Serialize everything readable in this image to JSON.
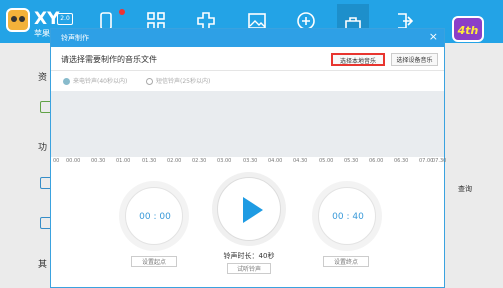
{
  "app": {
    "brand": "XY",
    "brand_sub": "苹果",
    "version": "2.0",
    "badge": "4th"
  },
  "nav": {
    "icons": [
      "phone-icon",
      "apps-icon",
      "puzzle-icon",
      "picture-icon",
      "plus-icon",
      "bag-icon",
      "export-icon"
    ]
  },
  "background": {
    "labels": [
      "资",
      "功",
      "其",
      "查询"
    ]
  },
  "dialog": {
    "title": "铃声制作",
    "close": "×",
    "prompt": "请选择需要制作的音乐文件",
    "btn_local": "选择本地音乐",
    "btn_device": "选择设备音乐",
    "radio_normal": "来电铃声(40秒以内)",
    "radio_sms": "短信铃声(25秒以内)",
    "ruler_ticks": [
      "00",
      "00.00",
      "00.30",
      "01.00",
      "01.30",
      "02.00",
      "02.30",
      "03.00",
      "03.30",
      "04.00",
      "04.30",
      "05.00",
      "05.30",
      "06.00",
      "06.30",
      "07.00",
      "07.30"
    ],
    "start_time": "00 : 00",
    "end_time": "00 : 40",
    "set_start": "设置起点",
    "set_end": "设置终点",
    "duration": "铃声时长：40秒",
    "try_listen": "试听铃声"
  },
  "colors": {
    "accent": "#23a3e6",
    "highlight": "#e8352f",
    "play": "#1e9be3"
  }
}
